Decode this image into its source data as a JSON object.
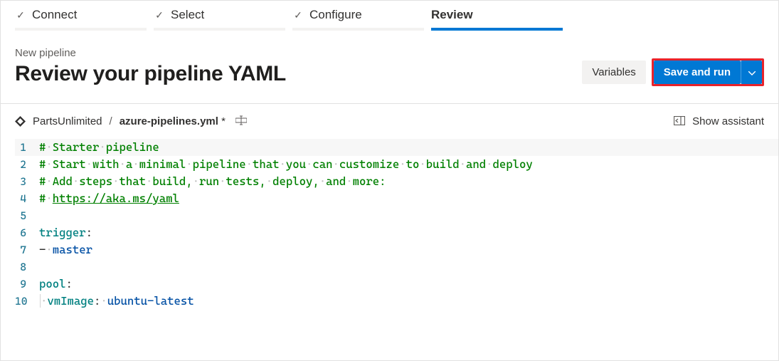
{
  "tabs": [
    {
      "label": "Connect",
      "done": true,
      "active": false
    },
    {
      "label": "Select",
      "done": true,
      "active": false
    },
    {
      "label": "Configure",
      "done": true,
      "active": false
    },
    {
      "label": "Review",
      "done": false,
      "active": true
    }
  ],
  "header": {
    "crumb": "New pipeline",
    "title": "Review your pipeline YAML",
    "variables_label": "Variables",
    "save_run_label": "Save and run"
  },
  "file": {
    "repo": "PartsUnlimited",
    "separator": "/",
    "name": "azure-pipelines.yml",
    "dirty_indicator": "*"
  },
  "assistant_label": "Show assistant",
  "editor": {
    "lines": [
      {
        "n": 1,
        "kind": "comment",
        "text": "# Starter pipeline"
      },
      {
        "n": 2,
        "kind": "comment",
        "text": "# Start with a minimal pipeline that you can customize to build and deploy"
      },
      {
        "n": 3,
        "kind": "comment",
        "text": "# Add steps that build, run tests, deploy, and more:"
      },
      {
        "n": 4,
        "kind": "comment-link",
        "prefix": "# ",
        "link": "https://aka.ms/yaml"
      },
      {
        "n": 5,
        "kind": "blank",
        "text": ""
      },
      {
        "n": 6,
        "kind": "key",
        "key": "trigger",
        "suffix": ":"
      },
      {
        "n": 7,
        "kind": "list-item",
        "dash": "- ",
        "value": "master"
      },
      {
        "n": 8,
        "kind": "blank",
        "text": ""
      },
      {
        "n": 9,
        "kind": "key",
        "key": "pool",
        "suffix": ":"
      },
      {
        "n": 10,
        "kind": "indented-kv",
        "indent": 1,
        "key": "vmImage",
        "sep": ": ",
        "value": "ubuntu-latest"
      }
    ]
  }
}
